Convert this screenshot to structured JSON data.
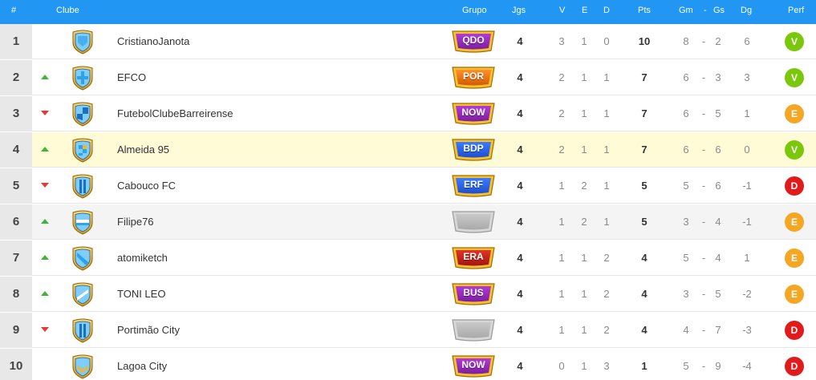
{
  "header": {
    "rank": "#",
    "club": "Clube",
    "group": "Grupo",
    "games": "Jgs",
    "wins": "V",
    "draws": "E",
    "losses": "D",
    "points": "Pts",
    "goals_for": "Gm",
    "dash1": "-",
    "goals_against": "Gs",
    "goal_diff": "Dg",
    "form": "Perf"
  },
  "colors": {
    "header": "#2196f3",
    "up_arrow": "#43b43a",
    "down_arrow": "#e53935",
    "win": "#7ac70c",
    "draw": "#f5a623",
    "loss": "#e01b1b",
    "highlight_row": "#fffbd6"
  },
  "rows": [
    {
      "rank": "1",
      "trend": "none",
      "shield": "blue-shield-icon",
      "club": "CristianoJanota",
      "group": "QDO",
      "badge_color": "purple",
      "games": "4",
      "wins": "3",
      "draws": "1",
      "losses": "0",
      "points": "10",
      "gf": "8",
      "dash": "-",
      "ga": "2",
      "gd": "6",
      "form": "V"
    },
    {
      "rank": "2",
      "trend": "up",
      "shield": "cross-shield-icon",
      "club": "EFCO",
      "group": "POR",
      "badge_color": "orange",
      "games": "4",
      "wins": "2",
      "draws": "1",
      "losses": "1",
      "points": "7",
      "gf": "6",
      "dash": "-",
      "ga": "3",
      "gd": "3",
      "form": "V"
    },
    {
      "rank": "3",
      "trend": "down",
      "shield": "quarter-shield-icon",
      "club": "FutebolClubeBarreirense",
      "group": "NOW",
      "badge_color": "purple",
      "games": "4",
      "wins": "2",
      "draws": "1",
      "losses": "1",
      "points": "7",
      "gf": "6",
      "dash": "-",
      "ga": "5",
      "gd": "1",
      "form": "E"
    },
    {
      "rank": "4",
      "trend": "up",
      "shield": "checkered-shield-icon",
      "club": "Almeida 95",
      "group": "BDP",
      "badge_color": "blue",
      "games": "4",
      "wins": "2",
      "draws": "1",
      "losses": "1",
      "points": "7",
      "gf": "6",
      "dash": "-",
      "ga": "6",
      "gd": "0",
      "form": "V"
    },
    {
      "rank": "5",
      "trend": "down",
      "shield": "stripe-shield-icon",
      "club": "Cabouco FC",
      "group": "ERF",
      "badge_color": "blue",
      "games": "4",
      "wins": "1",
      "draws": "2",
      "losses": "1",
      "points": "5",
      "gf": "5",
      "dash": "-",
      "ga": "6",
      "gd": "-1",
      "form": "D"
    },
    {
      "rank": "6",
      "trend": "up",
      "shield": "band-shield-icon",
      "club": "Filipe76",
      "group": "",
      "badge_color": "gray",
      "games": "4",
      "wins": "1",
      "draws": "2",
      "losses": "1",
      "points": "5",
      "gf": "3",
      "dash": "-",
      "ga": "4",
      "gd": "-1",
      "form": "E"
    },
    {
      "rank": "7",
      "trend": "up",
      "shield": "diagonal-shield-icon",
      "club": "atomiketch",
      "group": "ERA",
      "badge_color": "red",
      "games": "4",
      "wins": "1",
      "draws": "1",
      "losses": "2",
      "points": "4",
      "gf": "5",
      "dash": "-",
      "ga": "4",
      "gd": "1",
      "form": "E"
    },
    {
      "rank": "8",
      "trend": "up",
      "shield": "sash-shield-icon",
      "club": "TONI LEO",
      "group": "BUS",
      "badge_color": "purple",
      "games": "4",
      "wins": "1",
      "draws": "1",
      "losses": "2",
      "points": "4",
      "gf": "3",
      "dash": "-",
      "ga": "5",
      "gd": "-2",
      "form": "E"
    },
    {
      "rank": "9",
      "trend": "down",
      "shield": "stripe-shield-icon",
      "club": "Portimão City",
      "group": "",
      "badge_color": "gray",
      "games": "4",
      "wins": "1",
      "draws": "1",
      "losses": "2",
      "points": "4",
      "gf": "4",
      "dash": "-",
      "ga": "7",
      "gd": "-3",
      "form": "D"
    },
    {
      "rank": "10",
      "trend": "none",
      "shield": "chevron-shield-icon",
      "club": "Lagoa City",
      "group": "NOW",
      "badge_color": "purple",
      "games": "4",
      "wins": "0",
      "draws": "1",
      "losses": "3",
      "points": "1",
      "gf": "5",
      "dash": "-",
      "ga": "9",
      "gd": "-4",
      "form": "D"
    }
  ]
}
